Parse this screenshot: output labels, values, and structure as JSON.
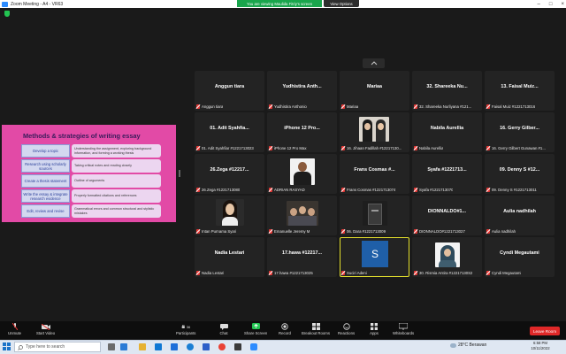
{
  "window": {
    "title": "Zoom Meeting - A4 - VR63"
  },
  "banner": {
    "viewing": "You are viewing Maulida Fitriy's screen",
    "view_options": "View Options"
  },
  "slide": {
    "title": "Methods & strategies of writing essay",
    "rows": [
      {
        "label": "Develop a topic",
        "desc": "Understanding the assignment, exploring background information, and forming a working thesis"
      },
      {
        "label": "Research using scholarly sources",
        "desc": "Taking critical notes and reading closely"
      },
      {
        "label": "Create a thesis statement",
        "desc": "Outline of arguments"
      },
      {
        "label": "Write the essay & integrate research evidence",
        "desc": "Properly formatted citations and references"
      },
      {
        "label": "Edit, review and revise",
        "desc": "Grammatical errors and common structural and stylistic mistakes"
      }
    ]
  },
  "tiles": [
    {
      "center": "Anggun tiara",
      "name": "Anggun tiara"
    },
    {
      "center": "Yudhistira Anth...",
      "name": "Yudhistira Anthonio"
    },
    {
      "center": "Mariaa",
      "name": "Mariaa"
    },
    {
      "center": "32. Shareeka Nu...",
      "name": "32. Shareeka Nurliyana #121..."
    },
    {
      "center": "13. Faisal Muiz...",
      "name": "Faisal Muiz #1221713016"
    },
    {
      "center": "01. Adit Syahfia...",
      "name": "01. Adit Syahfiar #1221713023"
    },
    {
      "center": "iPhone 12 Pro...",
      "name": "iPhone 12 Pro Max"
    },
    {
      "center": "",
      "name": "16. Jihaan Fadillah #12217130..."
    },
    {
      "center": "Nabila Aurellia",
      "name": "Nabila Aurellia"
    },
    {
      "center": "16. Gerry Gilber...",
      "name": "16. Gerry Gilbert Gunawan #1..."
    },
    {
      "center": "26.Zega #12217...",
      "name": "26.Zega #1221713080"
    },
    {
      "center": "",
      "name": "ADRIAN RASYAD"
    },
    {
      "center": "Frans Cosmas #...",
      "name": "Frans Cosmas #1221713074"
    },
    {
      "center": "Syafa #1221713...",
      "name": "Syafa #1221713070"
    },
    {
      "center": "09. Denny S #12...",
      "name": "09. Denny S #1221713011"
    },
    {
      "center": "",
      "name": "Intan Purnama Syari"
    },
    {
      "center": "",
      "name": "Emanuelle Jeremy M"
    },
    {
      "center": "",
      "name": "06. Dara #1221713009"
    },
    {
      "center": "DIONNALDO#1...",
      "name": "DIONNALDO#1221713027"
    },
    {
      "center": "Aulia nadhilah",
      "name": "Aulia nadhilah"
    },
    {
      "center": "Nadia Lestari",
      "name": "Nadia Lestari"
    },
    {
      "center": "17.hawa #12217...",
      "name": "17.hawa #1221713025"
    },
    {
      "center": "S",
      "name": "Suciri Adeni"
    },
    {
      "center": "",
      "name": "30. Rismia Antira #12217130S2"
    },
    {
      "center": "Cyndi Megautami",
      "name": "Cyndi Megautami"
    }
  ],
  "toolbar": {
    "unmute": "Unmute",
    "start_video": "Start Video",
    "participants": "Participants",
    "participants_count": "36",
    "chat": "Chat",
    "share_screen": "Share Screen",
    "record": "Record",
    "breakout": "Breakout Rooms",
    "reactions": "Reactions",
    "apps": "Apps",
    "whiteboards": "Whiteboards",
    "leave": "Leave Room"
  },
  "taskbar": {
    "search_placeholder": "Type here to search",
    "weather": "28°C  Berawan",
    "time": "6:58 PM",
    "date": "10/11/2022"
  },
  "colors": {
    "slide_bg": "#e24aa6",
    "leave": "#e02828",
    "share": "#23c552",
    "speaking": "#e6e22e"
  }
}
